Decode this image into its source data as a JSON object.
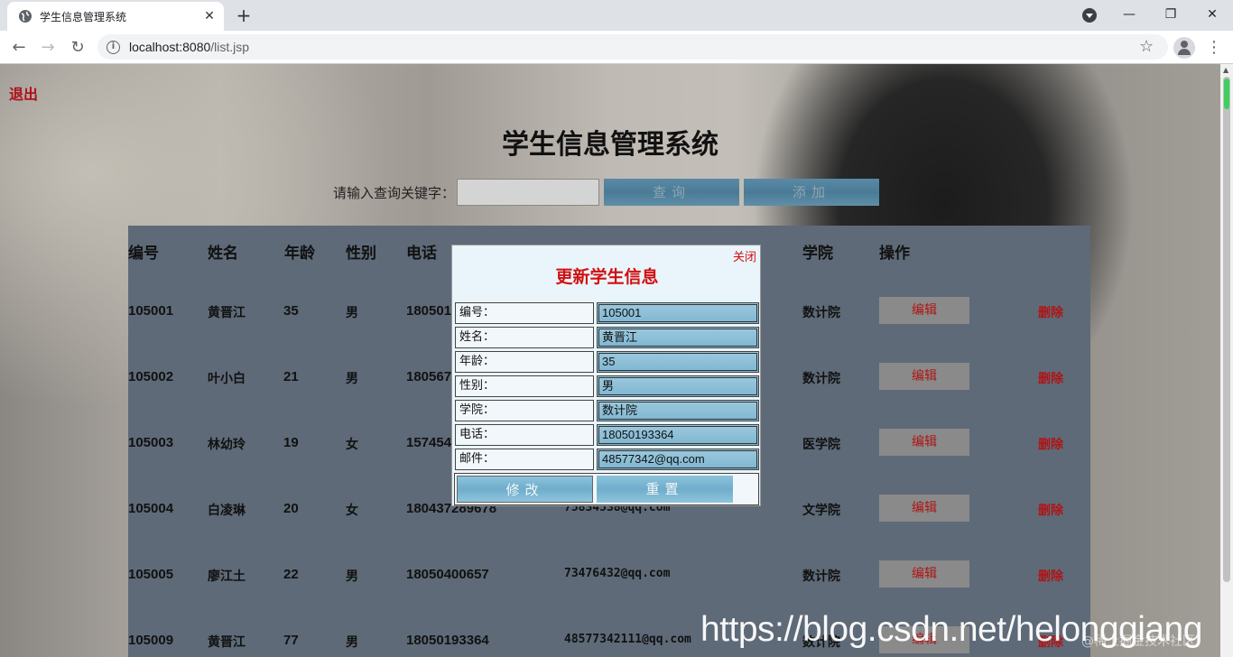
{
  "browser": {
    "tab_title": "学生信息管理系统",
    "tab_close": "✕",
    "new_tab": "+",
    "url_host": "localhost:8080",
    "url_path": "/list.jsp",
    "window_controls": {
      "minimize": "—",
      "maximize": "❐",
      "close": "✕"
    }
  },
  "page": {
    "logout": "退出",
    "title": "学生信息管理系统",
    "search_label": "请输入查询关键字：",
    "search_value": "",
    "query_button": "查询",
    "add_button": "添加"
  },
  "table": {
    "headers": {
      "id": "编号",
      "name": "姓名",
      "age": "年龄",
      "gender": "性别",
      "phone": "电话",
      "college": "学院",
      "action": "操作"
    },
    "edit_label": "编辑",
    "delete_label": "删除",
    "rows": [
      {
        "id": "105001",
        "name": "黄晋江",
        "age": "35",
        "gender": "男",
        "phone": "180501",
        "email": "",
        "college": "数计院"
      },
      {
        "id": "105002",
        "name": "叶小白",
        "age": "21",
        "gender": "男",
        "phone": "180567",
        "email": "",
        "college": "数计院"
      },
      {
        "id": "105003",
        "name": "林幼玲",
        "age": "19",
        "gender": "女",
        "phone": "157454",
        "email": "",
        "college": "医学院"
      },
      {
        "id": "105004",
        "name": "白凌琳",
        "age": "20",
        "gender": "女",
        "phone": "180437289678",
        "email": "75834538@qq.com",
        "college": "文学院"
      },
      {
        "id": "105005",
        "name": "廖江土",
        "age": "22",
        "gender": "男",
        "phone": "18050400657",
        "email": "73476432@qq.com",
        "college": "数计院"
      },
      {
        "id": "105009",
        "name": "黄晋江",
        "age": "77",
        "gender": "男",
        "phone": "18050193364",
        "email": "48577342111@qq.com",
        "college": "数计院"
      }
    ]
  },
  "modal": {
    "close": "关闭",
    "title": "更新学生信息",
    "fields": [
      {
        "label": "编号：",
        "value": "105001"
      },
      {
        "label": "姓名：",
        "value": "黄晋江"
      },
      {
        "label": "年龄：",
        "value": "35"
      },
      {
        "label": "性别：",
        "value": "男"
      },
      {
        "label": "学院：",
        "value": "数计院"
      },
      {
        "label": "电话：",
        "value": "18050193364"
      },
      {
        "label": "邮件：",
        "value": "48577342@qq.com"
      }
    ],
    "submit": "修改",
    "reset": "重置"
  },
  "watermark": "https://blog.csdn.net/helonggiang",
  "watermark_small": "@稀土掘金技术社区",
  "colors": {
    "accent_red": "#d01010",
    "panel": "#5e6a78",
    "button_blue": "#5a8aa4"
  }
}
